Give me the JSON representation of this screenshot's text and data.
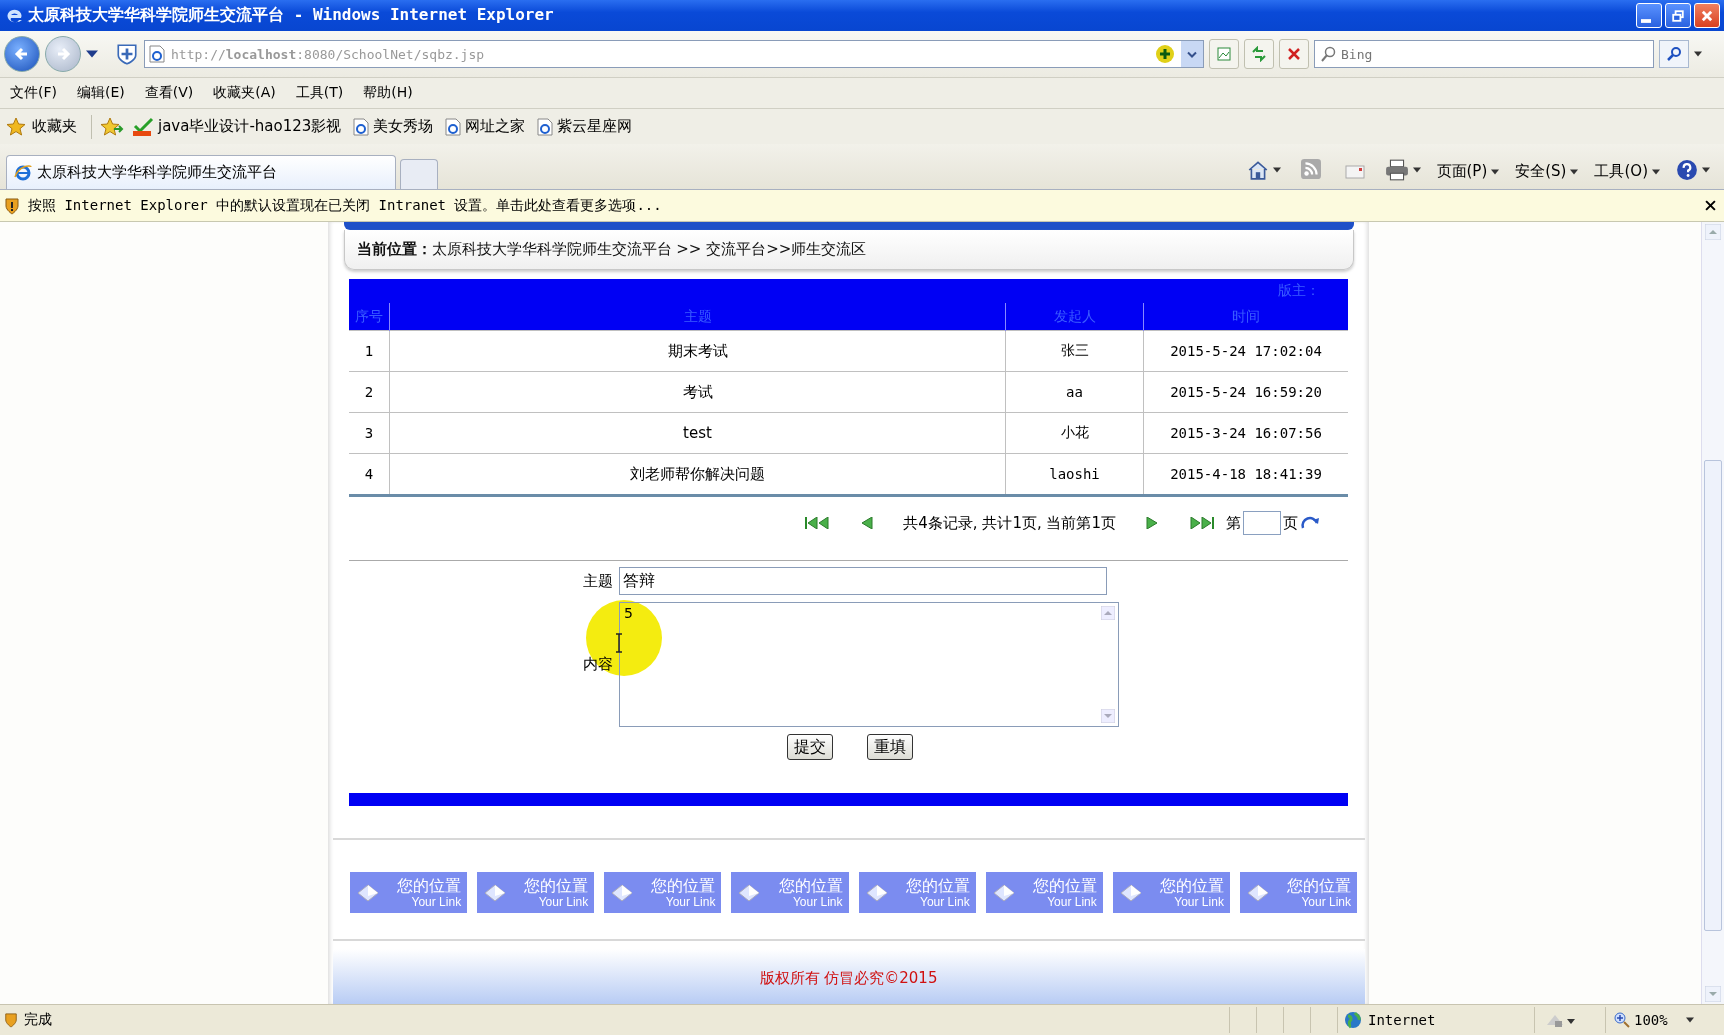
{
  "window": {
    "title": "太原科技大学华科学院师生交流平台 - Windows Internet Explorer"
  },
  "address": {
    "url": "http://**localhost**:8080/SchoolNet/sqbz.jsp"
  },
  "search": {
    "placeholder": "Bing"
  },
  "menu": [
    "文件(F)",
    "编辑(E)",
    "查看(V)",
    "收藏夹(A)",
    "工具(T)",
    "帮助(H)"
  ],
  "favorites": {
    "label": "收藏夹",
    "items": [
      {
        "kind": "hao",
        "label": "java毕业设计-hao123影视"
      },
      {
        "kind": "page",
        "label": "美女秀场"
      },
      {
        "kind": "page",
        "label": "网址之家"
      },
      {
        "kind": "page",
        "label": "紫云星座网"
      }
    ]
  },
  "tabs": [
    {
      "title": "太原科技大学华科学院师生交流平台",
      "selected": true
    }
  ],
  "commands": [
    "页面(P)",
    "安全(S)",
    "工具(O)"
  ],
  "info_bar": "按照 Internet Explorer 中的默认设置现在已关闭 Intranet 设置。单击此处查看更多选项...",
  "breadcrumb": "**当前位置：**太原科技大学华科学院师生交流平台 >> 交流平台>>师生交流区",
  "board_owner": "版主：",
  "table": {
    "columns": [
      "序号",
      "主题",
      "发起人",
      "时间"
    ],
    "rows": [
      [
        "1",
        "期末考试",
        "张三",
        "2015-5-24 17:02:04"
      ],
      [
        "2",
        "考试",
        "aa",
        "2015-5-24 16:59:20"
      ],
      [
        "3",
        "test",
        "小花",
        "2015-3-24 16:07:56"
      ],
      [
        "4",
        "刘老师帮你解决问题",
        "laoshi",
        "2015-4-18 18:41:39"
      ]
    ]
  },
  "pager": {
    "summary": "共4条记录, 共计1页, 当前第1页",
    "before": "第",
    "after": "页"
  },
  "form": {
    "subject_label": "主题",
    "subject": "答辩",
    "content_label": "内容",
    "content": "5",
    "buttons": [
      "提交",
      "重填"
    ]
  },
  "footer_links": [
    {
      "title": "您的位置",
      "subtitle": "Your Link"
    },
    {
      "title": "您的位置",
      "subtitle": "Your Link"
    },
    {
      "title": "您的位置",
      "subtitle": "Your Link"
    },
    {
      "title": "您的位置",
      "subtitle": "Your Link"
    },
    {
      "title": "您的位置",
      "subtitle": "Your Link"
    },
    {
      "title": "您的位置",
      "subtitle": "Your Link"
    },
    {
      "title": "您的位置",
      "subtitle": "Your Link"
    },
    {
      "title": "您的位置",
      "subtitle": "Your Link"
    }
  ],
  "copyright": "版权所有  仿冒必究©2015",
  "status_bar": {
    "text": "完成",
    "zone": "Internet",
    "zoom": "100%"
  }
}
